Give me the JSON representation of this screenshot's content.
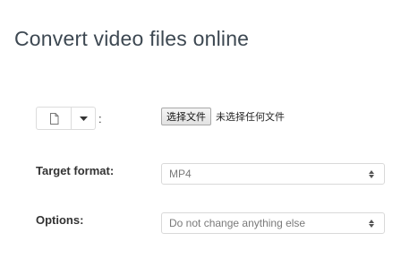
{
  "page": {
    "title": "Convert video files online"
  },
  "source": {
    "file_icon": "file-icon",
    "dropdown_icon": "caret-down-icon",
    "separator": ":"
  },
  "file_input": {
    "button_label": "选择文件",
    "status_text": "未选择任何文件"
  },
  "target_format": {
    "label": "Target format:",
    "selected": "MP4"
  },
  "options": {
    "label": "Options:",
    "selected": "Do not change anything else"
  }
}
